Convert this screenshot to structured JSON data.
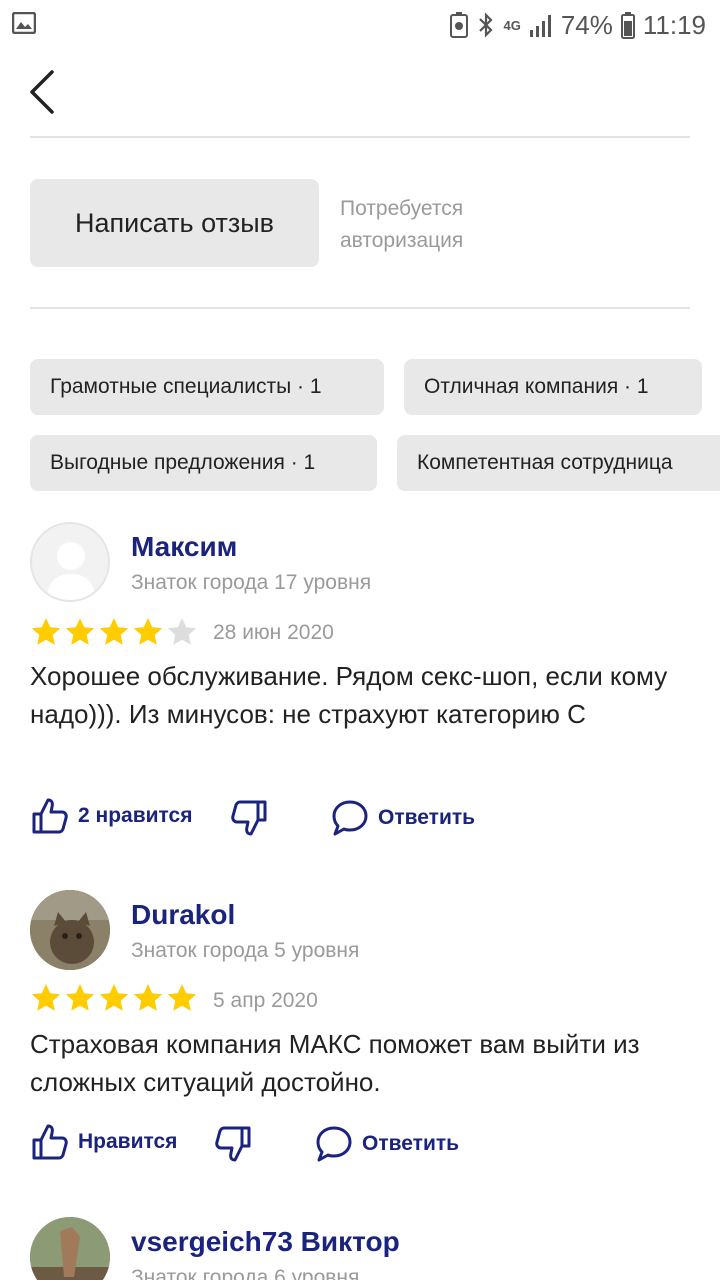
{
  "status_bar": {
    "network": "4G",
    "battery": "74%",
    "time": "11:19"
  },
  "write_review": {
    "button_label": "Написать отзыв",
    "note_line1": "Потребуется",
    "note_line2": "авторизация"
  },
  "tags": [
    "Грамотные специалисты · 1",
    "Отличная компания · 1",
    "Выгодные предложения · 1",
    "Компетентная сотрудница"
  ],
  "reviews": [
    {
      "author": "Максим",
      "level": "Знаток города 17 уровня",
      "rating": 4,
      "date": "28 июн 2020",
      "text": "Хорошее обслуживание. Рядом секс-шоп, если кому надо))). Из минусов: не страхуют категорию С",
      "like_label": "2 нравится",
      "reply_label": "Ответить"
    },
    {
      "author": "Durakol",
      "level": "Знаток города 5 уровня",
      "rating": 5,
      "date": "5 апр 2020",
      "text": "Страховая компания МАКС поможет вам выйти из сложных ситуаций достойно.",
      "like_label": "Нравится",
      "reply_label": "Ответить"
    },
    {
      "author": "vsergeich73 Виктор",
      "level": "Знаток города 6 уровня"
    }
  ],
  "colors": {
    "accent": "#1a237e",
    "star": "#ffcc00",
    "star_empty": "#dddddd",
    "chip_bg": "#e8e8e8"
  }
}
